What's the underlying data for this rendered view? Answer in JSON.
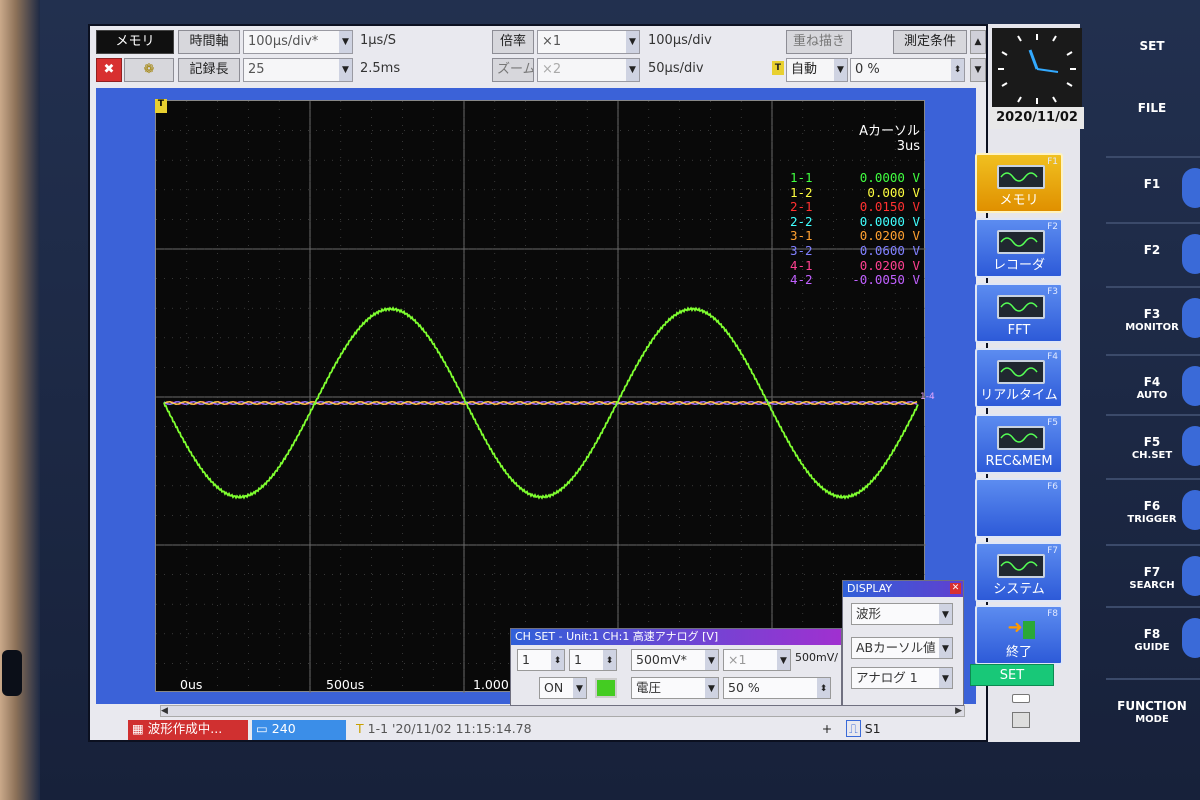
{
  "toolbar": {
    "row1": {
      "mode": "メモリ",
      "time_axis_label": "時間軸",
      "time_axis_value": "100μs/div*",
      "sample_rate": "1μs/S",
      "magnification_label": "倍率",
      "magnification_value": "×1",
      "magnified_div": "100μs/div",
      "overlay_label": "重ね描き",
      "measurement_conditions": "測定条件"
    },
    "row2": {
      "close_glyph": "✖",
      "gear_glyph": "❁",
      "record_length_label": "記録長",
      "record_length_value": "25",
      "record_time": "2.5ms",
      "zoom_label": "ズーム",
      "zoom_value": "×2",
      "zoom_div": "50μs/div",
      "trigger_icon": "T",
      "trigger_mode": "自動",
      "pretrigger": "0 %"
    }
  },
  "clock": {
    "date": "2020/11/02"
  },
  "cursor": {
    "title": "Aカーソル",
    "time": "3us"
  },
  "readouts": [
    {
      "ch": "1-1",
      "value": "0.0000 V",
      "color": "#40ff40"
    },
    {
      "ch": "1-2",
      "value": "0.000 V",
      "color": "#ffff40"
    },
    {
      "ch": "2-1",
      "value": "0.0150 V",
      "color": "#ff3030"
    },
    {
      "ch": "2-2",
      "value": "0.0000 V",
      "color": "#40ffff"
    },
    {
      "ch": "3-1",
      "value": "0.0200 V",
      "color": "#ffa030"
    },
    {
      "ch": "3-2",
      "value": "0.0600 V",
      "color": "#8080ff"
    },
    {
      "ch": "4-1",
      "value": "0.0200 V",
      "color": "#ff4090"
    },
    {
      "ch": "4-2",
      "value": "-0.0050 V",
      "color": "#c060ff"
    }
  ],
  "x_axis": {
    "t0": "0us",
    "t1": "500us",
    "t2": "1.000"
  },
  "marker_label": "1-4",
  "status": {
    "message": "波形作成中...",
    "count": "240",
    "file_info": "1-1 '20/11/02 11:15:14.78",
    "s_label": "S1"
  },
  "function_keys": [
    {
      "fn": "F1",
      "label": "メモリ",
      "icon": "memory-icon",
      "active": true
    },
    {
      "fn": "F2",
      "label": "レコーダ",
      "icon": "recorder-icon"
    },
    {
      "fn": "F3",
      "label": "FFT",
      "icon": "fft-icon"
    },
    {
      "fn": "F4",
      "label": "リアルタイム",
      "icon": "realtime-icon"
    },
    {
      "fn": "F5",
      "label": "REC&MEM",
      "icon": "recmem-icon"
    },
    {
      "fn": "F6",
      "label": "",
      "icon": ""
    },
    {
      "fn": "F7",
      "label": "システム",
      "icon": "system-icon"
    },
    {
      "fn": "F8",
      "label": "終了",
      "icon": "exit-icon"
    }
  ],
  "set_button": "SET",
  "hardware_keys": [
    {
      "label": "SET",
      "sub": ""
    },
    {
      "label": "FILE",
      "sub": ""
    },
    {
      "label": "F1",
      "sub": ""
    },
    {
      "label": "F2",
      "sub": ""
    },
    {
      "label": "F3",
      "sub": "MONITOR"
    },
    {
      "label": "F4",
      "sub": "AUTO"
    },
    {
      "label": "F5",
      "sub": "CH.SET"
    },
    {
      "label": "F6",
      "sub": "TRIGGER"
    },
    {
      "label": "F7",
      "sub": "SEARCH"
    },
    {
      "label": "F8",
      "sub": "GUIDE"
    },
    {
      "label": "FUNCTION",
      "sub": "MODE"
    }
  ],
  "ch_set_dialog": {
    "title": "CH SET - Unit:1 CH:1 高速アナログ [V]",
    "unit": "1",
    "channel": "1",
    "range": "500mV*",
    "mult": "×1",
    "range_div": "500mV/",
    "onoff": "ON",
    "mode": "電圧",
    "position": "50 %"
  },
  "display_dialog": {
    "title": "DISPLAY",
    "item1": "波形",
    "item2": "ABカーソル値",
    "item3": "アナログ 1"
  },
  "colors": {
    "sine": "#7fff30",
    "screen_bg": "#3b62d8",
    "accent_active": "#f0b020"
  }
}
